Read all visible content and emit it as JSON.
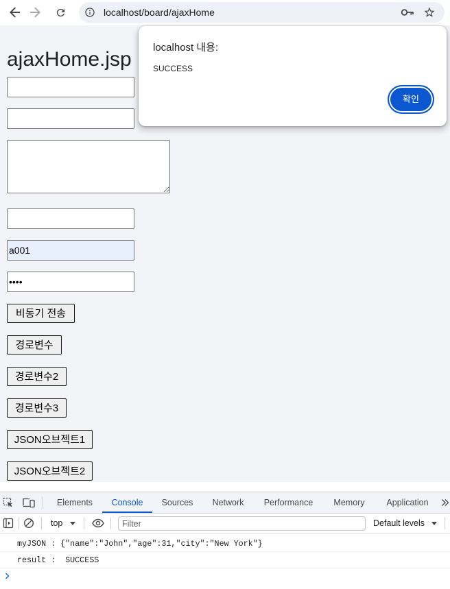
{
  "browser": {
    "url": "localhost/board/ajaxHome",
    "icons": [
      "back-arrow-icon",
      "forward-arrow-icon",
      "reload-icon",
      "site-info-icon",
      "password-key-icon",
      "bookmark-star-icon"
    ]
  },
  "page": {
    "title": "ajaxHome.jsp",
    "inputs": [
      {
        "value": ""
      },
      {
        "value": ""
      },
      {
        "value": ""
      },
      {
        "value": ""
      },
      {
        "value": "a001",
        "autofilled": true
      },
      {
        "value": "••••",
        "masked": true
      }
    ],
    "buttons": [
      {
        "label": "비동기 전송"
      },
      {
        "label": "경로변수"
      },
      {
        "label": "경로변수2"
      },
      {
        "label": "경로변수3"
      },
      {
        "label": "JSON오브젝트1"
      },
      {
        "label": "JSON오브젝트2"
      }
    ]
  },
  "alert": {
    "title": "localhost 내용:",
    "message": "SUCCESS",
    "ok_label": "확인"
  },
  "devtools": {
    "toolbar_icons": [
      "inspect-element-icon",
      "device-toolbar-icon",
      "more-tabs-chevron-icon"
    ],
    "tabs": [
      {
        "label": "Elements",
        "active": false
      },
      {
        "label": "Console",
        "active": true
      },
      {
        "label": "Sources",
        "active": false
      },
      {
        "label": "Network",
        "active": false
      },
      {
        "label": "Performance",
        "active": false
      },
      {
        "label": "Memory",
        "active": false
      },
      {
        "label": "Application",
        "active": false
      }
    ],
    "context": "top",
    "filter": {
      "value": "",
      "placeholder": "Filter"
    },
    "log_levels": "Default levels",
    "console_messages": [
      "myJSON : {\"name\":\"John\",\"age\":31,\"city\":\"New York\"}",
      "result :  SUCCESS"
    ],
    "console_icons": [
      "sidebar-toggle-icon",
      "clear-console-icon",
      "dropdown-arrow-icon",
      "live-expression-eye-icon",
      "console-prompt-chevron-icon"
    ]
  },
  "colors": {
    "accent": "#0b57d0",
    "page_bg": "#f3f4f8",
    "autofill_bg": "#e8f0fe",
    "tabbar_bg": "#f1f4f9",
    "prompt": "#1a73e8"
  }
}
